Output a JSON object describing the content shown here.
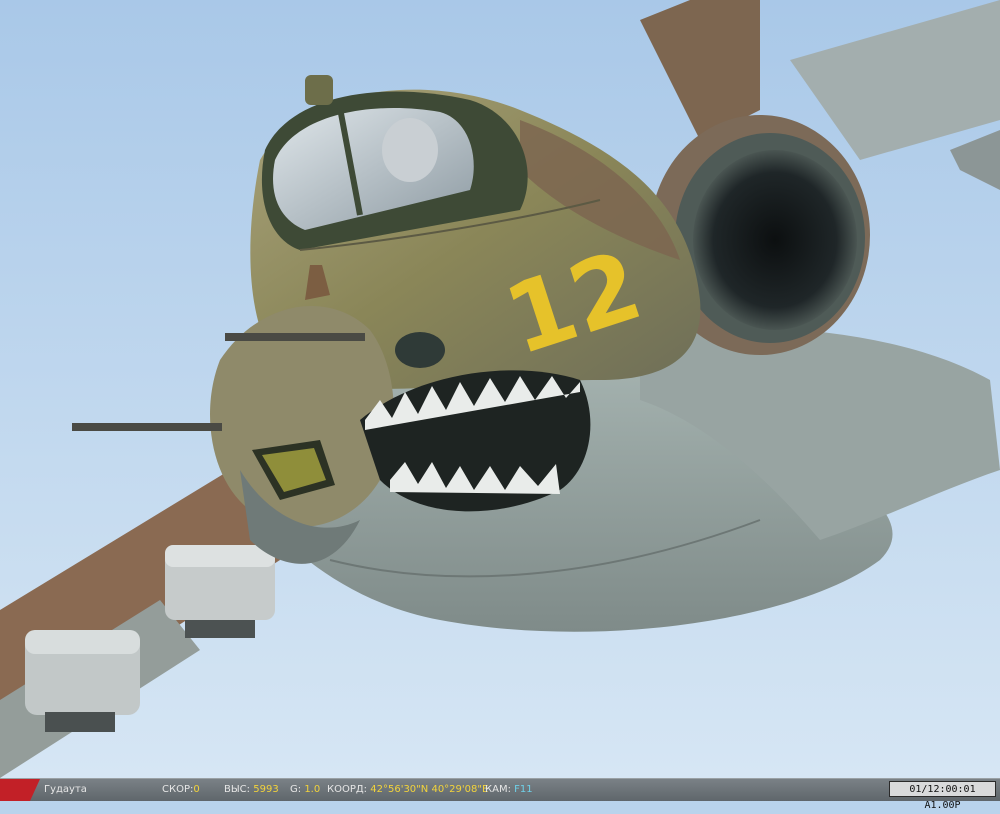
{
  "scene": {
    "description_icon": "aircraft-su25-nose-view",
    "tail_number": "12",
    "colors": {
      "sky": "#b9d3ec",
      "camo_green": "#8a8c5a",
      "camo_brown": "#8a6a52",
      "belly": "#9aa9a6",
      "number_yellow": "#e6c22a"
    }
  },
  "status": {
    "location": "Гудаута",
    "speed_label": "СКОР:",
    "speed_value": "0",
    "alt_label": "ВЫС:",
    "alt_value": "5993",
    "g_label": "G:",
    "g_value": "1.0",
    "coord_label": "КООРД:",
    "coord_lat": "42°56'30\"N",
    "coord_lon": "40°29'08\"E",
    "cam_label": "КАМ:",
    "cam_value": "F11",
    "time_display": "01/12:00:01 A1.00P"
  }
}
